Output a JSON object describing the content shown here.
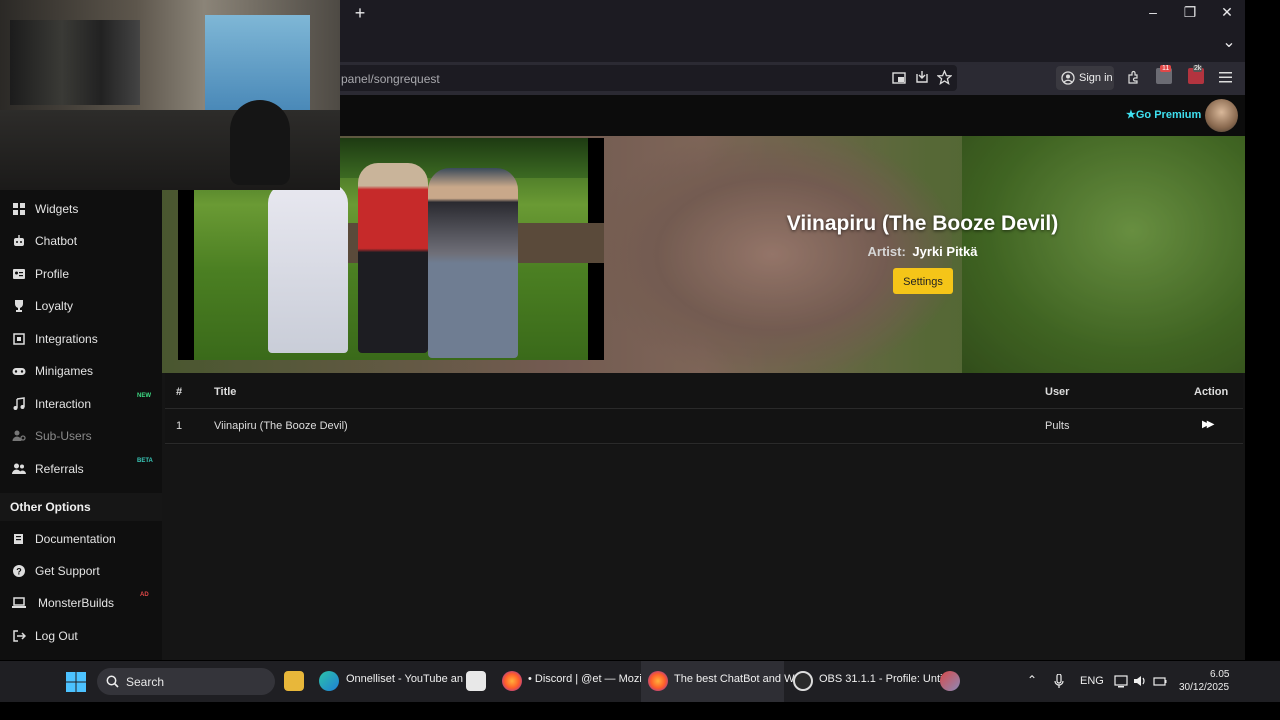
{
  "browser": {
    "url": "panel/songrequest",
    "new_tab": "+",
    "sign_in": "Sign in",
    "ext_badge_1": "11",
    "ext_badge_2": "2k",
    "window_minimize": "–",
    "window_restore": "❐",
    "window_close": "✕",
    "tab_list": "⌄"
  },
  "header": {
    "go_premium": "Go Premium"
  },
  "sidebar": {
    "items": [
      {
        "label": "Widgets",
        "icon": "grid-icon"
      },
      {
        "label": "Chatbot",
        "icon": "robot-icon"
      },
      {
        "label": "Profile",
        "icon": "id-card-icon"
      },
      {
        "label": "Loyalty",
        "icon": "trophy-icon"
      },
      {
        "label": "Integrations",
        "icon": "plug-icon"
      },
      {
        "label": "Minigames",
        "icon": "gamepad-icon"
      },
      {
        "label": "Interaction",
        "icon": "music-icon",
        "badge": "NEW"
      },
      {
        "label": "Sub-Users",
        "icon": "users-cog-icon"
      },
      {
        "label": "Referrals",
        "icon": "users-icon",
        "badge": "BETA"
      }
    ],
    "other_options_heading": "Other Options",
    "other_items": [
      {
        "label": "Documentation",
        "icon": "book-icon"
      },
      {
        "label": "Get Support",
        "icon": "question-icon"
      },
      {
        "label": "MonsterBuilds",
        "icon": "laptop-icon",
        "badge": "AD"
      },
      {
        "label": "Log Out",
        "icon": "logout-icon"
      }
    ]
  },
  "now_playing": {
    "title": "Viinapiru (The Booze Devil)",
    "artist_label": "Artist:",
    "artist": "Jyrki Pitkä",
    "settings_button": "Settings"
  },
  "queue": {
    "headers": {
      "num": "#",
      "title": "Title",
      "user": "User",
      "action": "Action"
    },
    "rows": [
      {
        "num": "1",
        "title": "Viinapiru (The Booze Devil)",
        "user": "Pults",
        "action": "▶▶"
      }
    ]
  },
  "taskbar": {
    "search": "Search",
    "apps": [
      {
        "label": "Onnelliset - YouTube an"
      },
      {
        "label": "• Discord | @et — Mozil"
      },
      {
        "label": "The best ChatBot and W"
      },
      {
        "label": "OBS 31.1.1 - Profile: Unti"
      }
    ],
    "language": "ENG",
    "time": "6.05",
    "date": "30/12/2025"
  },
  "colors": {
    "accent_yellow": "#f5c518",
    "premium_cyan": "#3fe0f0",
    "badge_green": "#3ddc84",
    "badge_teal": "#39c7b8",
    "badge_red": "#e04848"
  }
}
